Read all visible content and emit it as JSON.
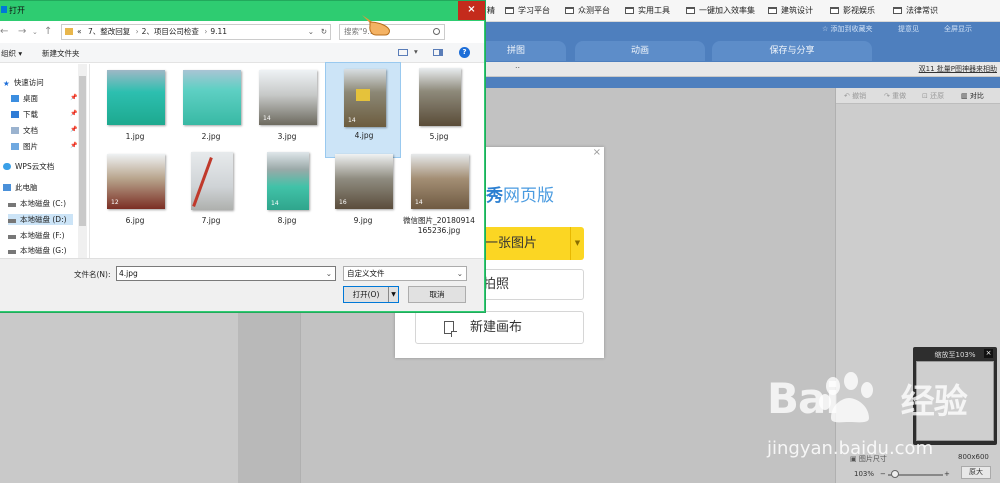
{
  "bookmarks": [
    "学习平台",
    "众测平台",
    "实用工具",
    "一键加入效率集",
    "建筑设计",
    "影视娱乐",
    "法律常识"
  ],
  "bookmark_partial": "精",
  "app": {
    "header_links": [
      "☆ 添加到收藏夹",
      "提意见",
      "全屏显示"
    ],
    "tabs": [
      "拼图",
      "动画",
      "保存与分享"
    ],
    "sublink": "双11 批量P图神器来相助",
    "right_tools": [
      "撤销",
      "重做",
      "还原"
    ],
    "contrast_label": "对比",
    "image_size_label": "图片尺寸",
    "image_size_value": "800x600",
    "zoom_percent": "103%",
    "original_size_btn": "原大"
  },
  "welcome": {
    "brand_left": "美图秀秀",
    "brand_right": "网页版",
    "open_image": "打开一张图片",
    "camera": "拍照",
    "new_canvas": "新建画布"
  },
  "zoom_panel": {
    "title": "缩放至103%",
    "close": "×"
  },
  "watermark": {
    "brand": "Bai",
    "brand_cn": "经验",
    "url": "jingyan.baidu.com"
  },
  "dialog": {
    "title": "打开",
    "close": "×",
    "breadcrumb": [
      "«",
      "7、整改回复",
      "2、项目公司检查",
      "9.11"
    ],
    "search_placeholder": "搜索\"9.11\"",
    "organize": "组织 ▾",
    "new_folder": "新建文件夹",
    "nav_items": [
      {
        "label": "快速访问",
        "pinned": false
      },
      {
        "label": "桌面",
        "pinned": true
      },
      {
        "label": "下载",
        "pinned": true
      },
      {
        "label": "文档",
        "pinned": true
      },
      {
        "label": "图片",
        "pinned": true
      },
      {
        "label": "WPS云文档",
        "pinned": false
      },
      {
        "label": "此电脑",
        "pinned": false
      },
      {
        "label": "本地磁盘 (C:)",
        "pinned": false
      },
      {
        "label": "本地磁盘 (D:)",
        "pinned": false
      },
      {
        "label": "本地磁盘 (F:)",
        "pinned": false
      },
      {
        "label": "本地磁盘 (G:)",
        "pinned": false
      }
    ],
    "files": [
      {
        "name": "1.jpg",
        "selected": false
      },
      {
        "name": "2.jpg",
        "selected": false
      },
      {
        "name": "3.jpg",
        "selected": false
      },
      {
        "name": "4.jpg",
        "selected": true
      },
      {
        "name": "5.jpg",
        "selected": false
      },
      {
        "name": "6.jpg",
        "selected": false
      },
      {
        "name": "7.jpg",
        "selected": false
      },
      {
        "name": "8.jpg",
        "selected": false
      },
      {
        "name": "9.jpg",
        "selected": false
      },
      {
        "name": "微信图片_20180914165236.jpg",
        "selected": false
      }
    ],
    "file_name_label": "文件名(N):",
    "file_name_value": "4.jpg",
    "file_type_value": "自定义文件",
    "open_btn": "打开(O)",
    "cancel_btn": "取消"
  },
  "colors": {
    "dialog_frame": "#2ecc71",
    "app_header": "#4e7fbe",
    "open_button_yellow": "#fbd623",
    "selected_tile": "#cce4f7",
    "close_red": "#c42b1c"
  }
}
